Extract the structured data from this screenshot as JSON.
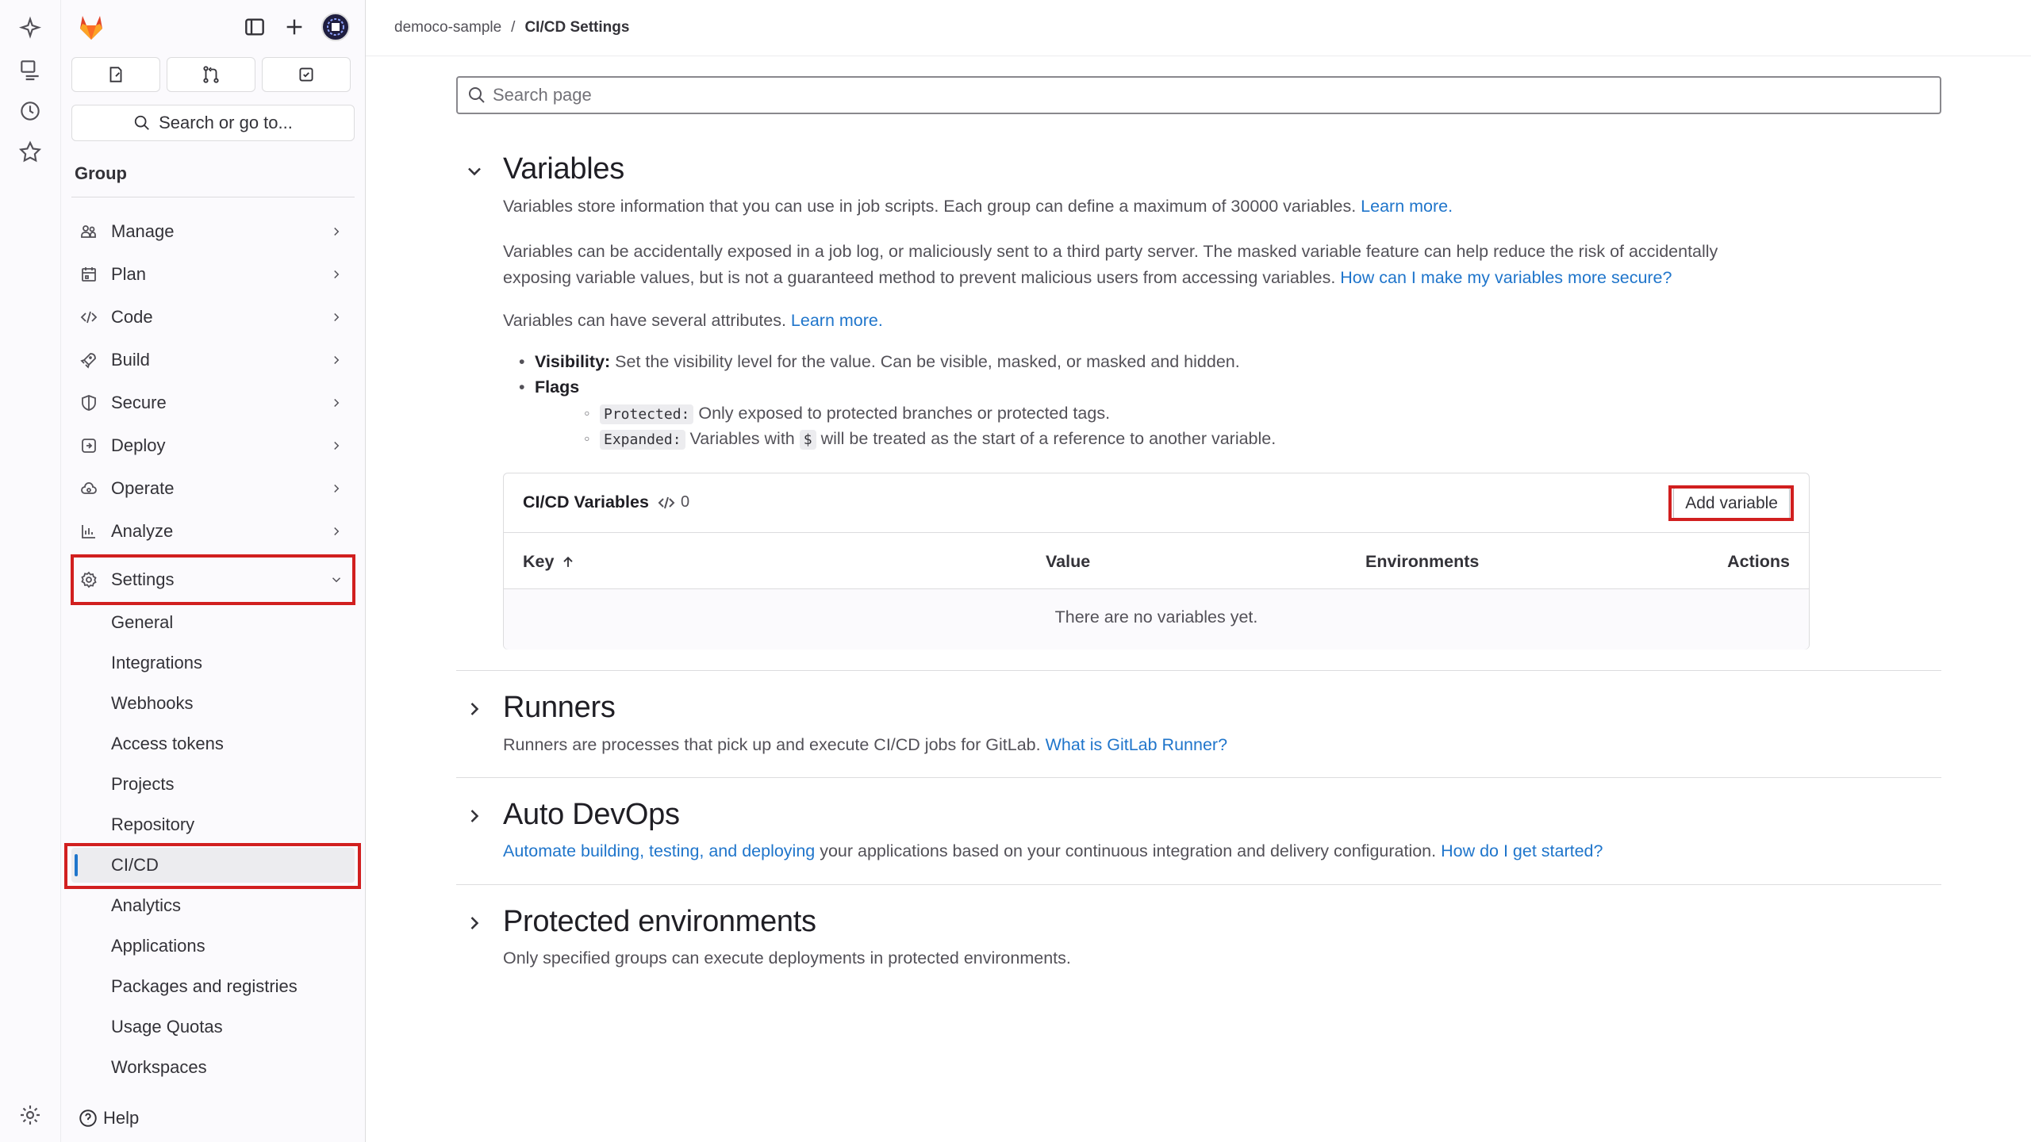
{
  "breadcrumb": {
    "group": "democo-sample",
    "separator": "/",
    "current": "CI/CD Settings"
  },
  "sidebar": {
    "search_label": "Search or go to...",
    "context_label": "Group",
    "nav": [
      {
        "label": "Manage",
        "icon": "users-icon"
      },
      {
        "label": "Plan",
        "icon": "calendar-icon"
      },
      {
        "label": "Code",
        "icon": "code-icon"
      },
      {
        "label": "Build",
        "icon": "rocket-icon"
      },
      {
        "label": "Secure",
        "icon": "shield-icon"
      },
      {
        "label": "Deploy",
        "icon": "deploy-icon"
      },
      {
        "label": "Operate",
        "icon": "cloud-icon"
      },
      {
        "label": "Analyze",
        "icon": "chart-icon"
      },
      {
        "label": "Settings",
        "icon": "gear-icon",
        "expanded": true
      }
    ],
    "settings_items": [
      "General",
      "Integrations",
      "Webhooks",
      "Access tokens",
      "Projects",
      "Repository",
      "CI/CD",
      "Analytics",
      "Applications",
      "Packages and registries",
      "Usage Quotas",
      "Workspaces"
    ],
    "active_item": "CI/CD",
    "help_label": "Help"
  },
  "search": {
    "placeholder": "Search page"
  },
  "variables": {
    "title": "Variables",
    "desc_text": "Variables store information that you can use in job scripts. Each group can define a maximum of 30000 variables. ",
    "desc_link": "Learn more.",
    "warn_line1": "Variables can be accidentally exposed in a job log, or maliciously sent to a third party server. The masked variable feature can help reduce the risk of accidentally",
    "warn_line2": "exposing variable values, but is not a guaranteed method to prevent malicious users from accessing variables. ",
    "warn_link": "How can I make my variables more secure?",
    "attrs_text": "Variables can have several attributes. ",
    "attrs_link": "Learn more.",
    "visibility_label": "Visibility:",
    "visibility_text": " Set the visibility level for the value. Can be visible, masked, or masked and hidden.",
    "flags_label": "Flags",
    "protected_code": "Protected:",
    "protected_text": " Only exposed to protected branches or protected tags.",
    "expanded_code": "Expanded:",
    "expanded_text_1": " Variables with ",
    "dollar_code": "$",
    "expanded_text_2": " will be treated as the start of a reference to another variable.",
    "card": {
      "title": "CI/CD Variables",
      "count": "0",
      "add_label": "Add variable",
      "columns": {
        "key": "Key",
        "value": "Value",
        "environments": "Environments",
        "actions": "Actions"
      },
      "empty": "There are no variables yet."
    }
  },
  "runners": {
    "title": "Runners",
    "text": "Runners are processes that pick up and execute CI/CD jobs for GitLab. ",
    "link": "What is GitLab Runner?"
  },
  "autodevops": {
    "title": "Auto DevOps",
    "link1": "Automate building, testing, and deploying",
    "text": " your applications based on your continuous integration and delivery configuration. ",
    "link2": "How do I get started?"
  },
  "protected_envs": {
    "title": "Protected environments",
    "text": "Only specified groups can execute deployments in protected environments."
  },
  "colors": {
    "link": "#1f75cb",
    "highlight": "#d11f1f",
    "active_indicator": "#1f75cb"
  }
}
